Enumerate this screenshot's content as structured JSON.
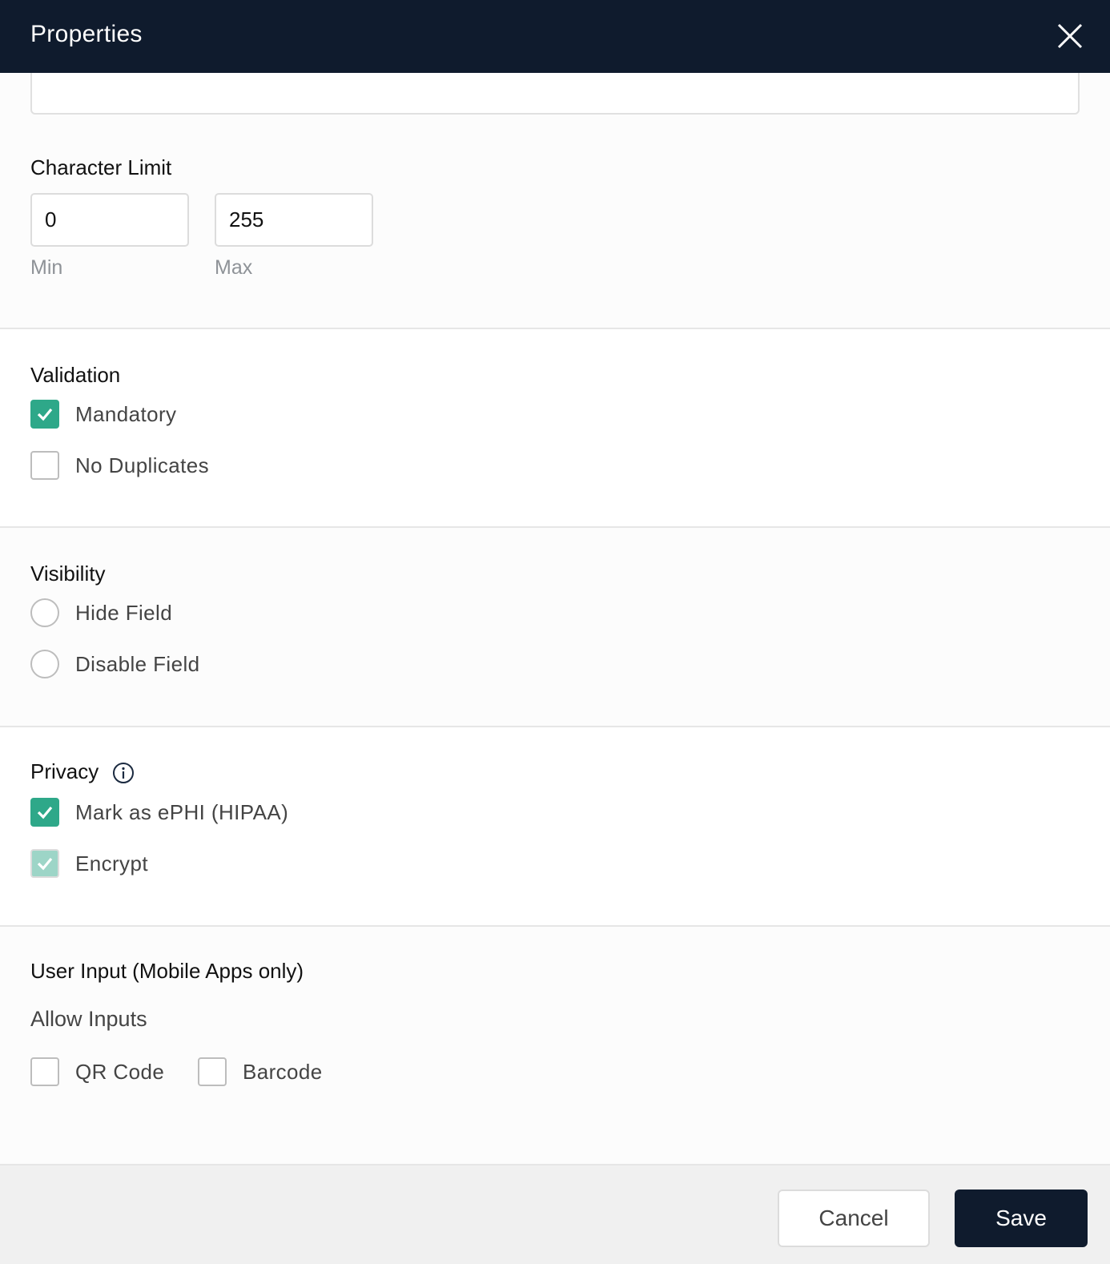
{
  "header": {
    "title": "Properties",
    "close_icon": "close-icon"
  },
  "top_field": {
    "value": ""
  },
  "character_limit": {
    "title": "Character Limit",
    "min": {
      "value": "0",
      "label": "Min"
    },
    "max": {
      "value": "255",
      "label": "Max"
    }
  },
  "validation": {
    "title": "Validation",
    "options": [
      {
        "label": "Mandatory",
        "checked": true
      },
      {
        "label": "No Duplicates",
        "checked": false
      }
    ]
  },
  "visibility": {
    "title": "Visibility",
    "options": [
      {
        "label": "Hide Field",
        "selected": false
      },
      {
        "label": "Disable Field",
        "selected": false
      }
    ]
  },
  "privacy": {
    "title": "Privacy",
    "info_icon": "info-icon",
    "options": [
      {
        "label": "Mark as ePHI (HIPAA)",
        "checked": true,
        "disabled": false
      },
      {
        "label": "Encrypt",
        "checked": true,
        "disabled": true
      }
    ]
  },
  "user_input": {
    "title": "User Input (Mobile Apps only)",
    "subtitle": "Allow Inputs",
    "options": [
      {
        "label": "QR Code",
        "checked": false
      },
      {
        "label": "Barcode",
        "checked": false
      }
    ]
  },
  "footer": {
    "cancel_label": "Cancel",
    "save_label": "Save"
  },
  "colors": {
    "header_bg": "#0f1b2d",
    "accent": "#2ea889",
    "accent_disabled": "#9dd5c7",
    "save_bg": "#0f1b2d"
  }
}
